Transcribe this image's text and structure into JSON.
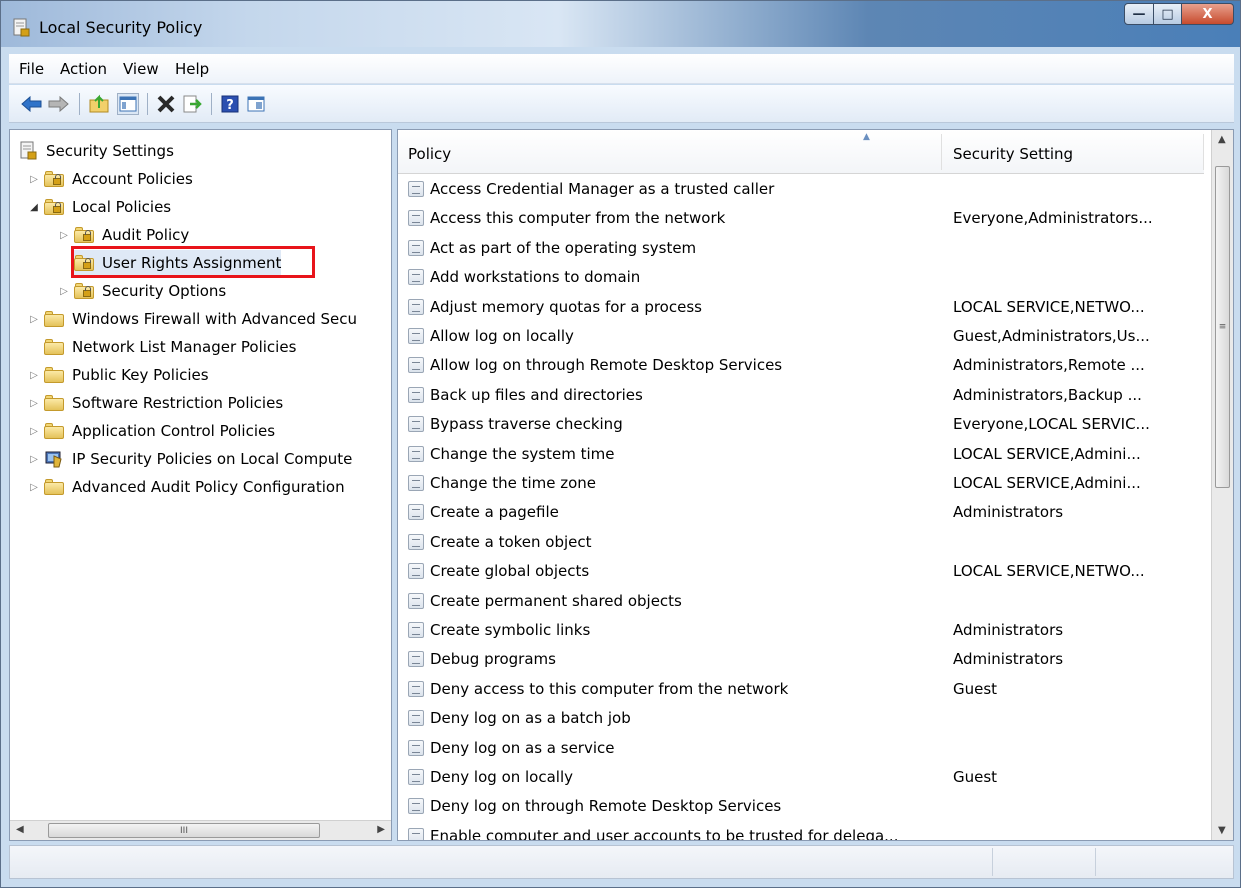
{
  "window": {
    "title": "Local Security Policy",
    "minimize_glyph": "—",
    "maximize_glyph": "□",
    "close_glyph": "X"
  },
  "menu": {
    "items": [
      {
        "label": "File"
      },
      {
        "label": "Action"
      },
      {
        "label": "View"
      },
      {
        "label": "Help"
      }
    ]
  },
  "toolbar": {
    "buttons": [
      {
        "icon": "back-arrow-icon",
        "color": "#2f73c9"
      },
      {
        "icon": "forward-arrow-icon",
        "color": "#8a8a8a"
      },
      {
        "icon": "up-folder-icon",
        "color": "#e3b84a"
      },
      {
        "icon": "show-hide-tree-icon",
        "color": "#3c73b5"
      },
      {
        "icon": "delete-icon",
        "color": "#2a2a2a"
      },
      {
        "icon": "export-list-icon",
        "color": "#3aa832"
      },
      {
        "icon": "help-icon",
        "color": "#2b4fb0"
      },
      {
        "icon": "properties-icon",
        "color": "#3c73b5"
      }
    ]
  },
  "tree": {
    "root": "Security Settings",
    "items": [
      {
        "label": "Account Policies",
        "expander": "▷"
      },
      {
        "label": "Local Policies",
        "expander": "◢"
      },
      {
        "label": "Audit Policy",
        "expander": "▷"
      },
      {
        "label": "User Rights Assignment",
        "expander": ""
      },
      {
        "label": "Security Options",
        "expander": "▷"
      },
      {
        "label": "Windows Firewall with Advanced Secu",
        "expander": "▷"
      },
      {
        "label": "Network List Manager Policies",
        "expander": ""
      },
      {
        "label": "Public Key Policies",
        "expander": "▷"
      },
      {
        "label": "Software Restriction Policies",
        "expander": "▷"
      },
      {
        "label": "Application Control Policies",
        "expander": "▷"
      },
      {
        "label": "IP Security Policies on Local Compute",
        "expander": "▷"
      },
      {
        "label": "Advanced Audit Policy Configuration",
        "expander": "▷"
      }
    ],
    "selected": "User Rights Assignment",
    "highlight_color": "#e8141a",
    "scroll_grip": "III"
  },
  "list": {
    "columns": {
      "policy": "Policy",
      "setting": "Security Setting"
    },
    "sort_glyph": "▲",
    "rows": [
      {
        "policy": "Access Credential Manager as a trusted caller",
        "setting": ""
      },
      {
        "policy": "Access this computer from the network",
        "setting": "Everyone,Administrators..."
      },
      {
        "policy": "Act as part of the operating system",
        "setting": ""
      },
      {
        "policy": "Add workstations to domain",
        "setting": ""
      },
      {
        "policy": "Adjust memory quotas for a process",
        "setting": "LOCAL SERVICE,NETWO..."
      },
      {
        "policy": "Allow log on locally",
        "setting": "Guest,Administrators,Us..."
      },
      {
        "policy": "Allow log on through Remote Desktop Services",
        "setting": "Administrators,Remote ..."
      },
      {
        "policy": "Back up files and directories",
        "setting": "Administrators,Backup ..."
      },
      {
        "policy": "Bypass traverse checking",
        "setting": "Everyone,LOCAL SERVIC..."
      },
      {
        "policy": "Change the system time",
        "setting": "LOCAL SERVICE,Admini..."
      },
      {
        "policy": "Change the time zone",
        "setting": "LOCAL SERVICE,Admini..."
      },
      {
        "policy": "Create a pagefile",
        "setting": "Administrators"
      },
      {
        "policy": "Create a token object",
        "setting": ""
      },
      {
        "policy": "Create global objects",
        "setting": "LOCAL SERVICE,NETWO..."
      },
      {
        "policy": "Create permanent shared objects",
        "setting": ""
      },
      {
        "policy": "Create symbolic links",
        "setting": "Administrators"
      },
      {
        "policy": "Debug programs",
        "setting": "Administrators"
      },
      {
        "policy": "Deny access to this computer from the network",
        "setting": "Guest"
      },
      {
        "policy": "Deny log on as a batch job",
        "setting": ""
      },
      {
        "policy": "Deny log on as a service",
        "setting": ""
      },
      {
        "policy": "Deny log on locally",
        "setting": "Guest"
      },
      {
        "policy": "Deny log on through Remote Desktop Services",
        "setting": ""
      },
      {
        "policy": "Enable computer and user accounts to be trusted for delega...",
        "setting": ""
      }
    ],
    "scroll_grip": "≡"
  }
}
